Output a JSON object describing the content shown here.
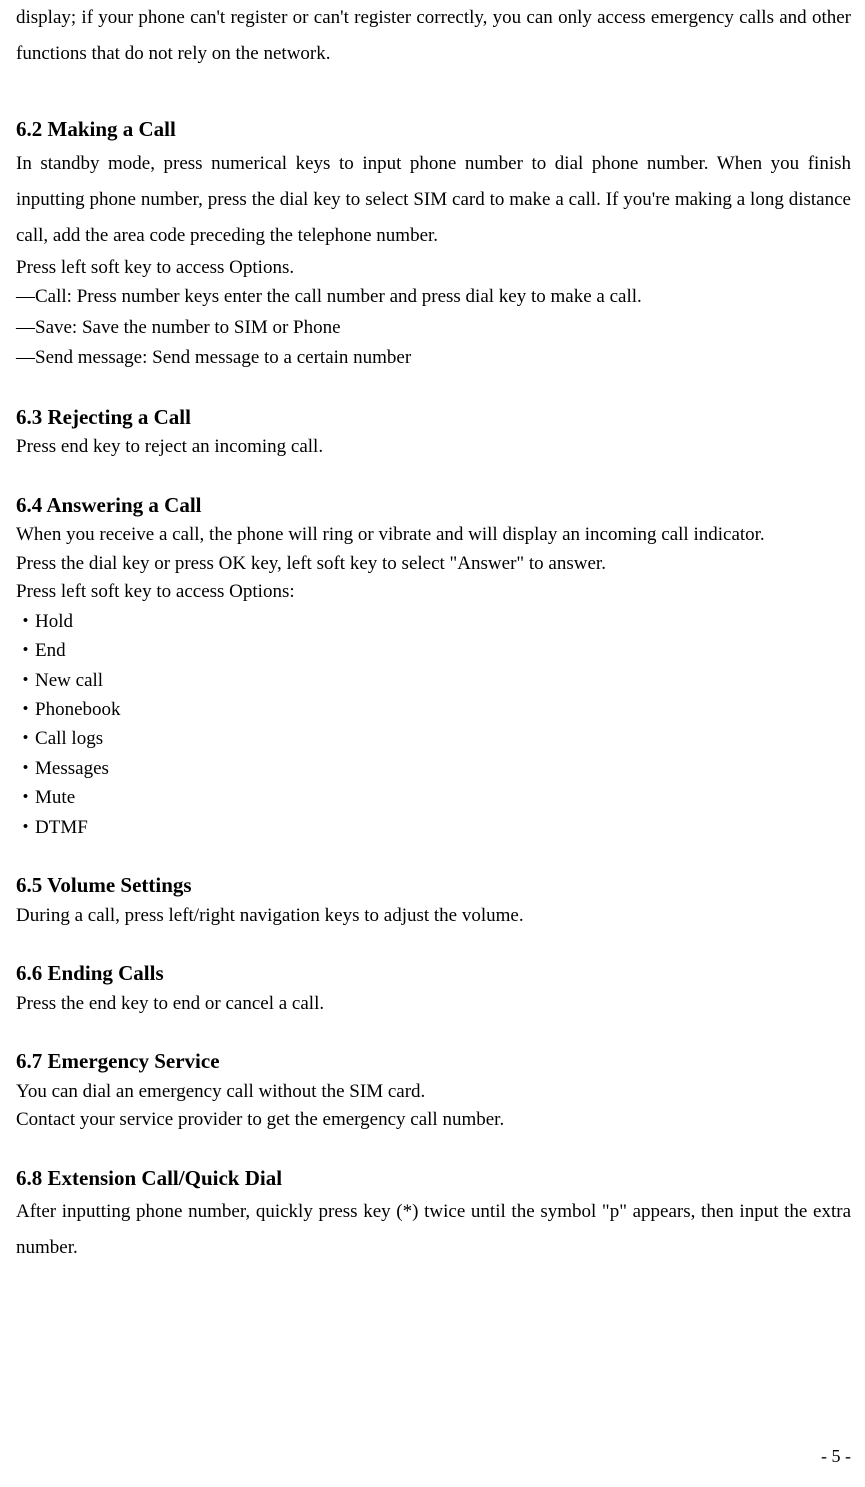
{
  "intro": {
    "p1": "display; if your phone can't register or can't register correctly, you can only access emergency calls and other functions that do not rely on the network."
  },
  "s62": {
    "heading": "6.2 Making a Call",
    "p1": "In standby mode, press numerical keys to input phone number to dial phone number. When you finish inputting phone number, press the dial key to select SIM card to make a call. If you're making a long distance call, add the area code preceding the telephone number.",
    "p2": "Press left soft key to access Options.",
    "items": [
      "Call: Press number keys enter the call number and press dial key to make a call.",
      "Save: Save the number to SIM or Phone",
      "Send message: Send message to a certain number"
    ]
  },
  "s63": {
    "heading": "6.3 Rejecting a Call",
    "p1": "Press end key to reject an incoming call."
  },
  "s64": {
    "heading": "6.4 Answering a Call",
    "p1": "When you receive a call, the phone will ring or vibrate and will display an incoming call indicator.",
    "p2": "Press the dial key or press OK key, left soft key to select \"Answer\" to answer.",
    "p3": "Press left soft key to access Options:",
    "bullets": [
      "Hold",
      "End",
      "New call",
      "Phonebook",
      "Call logs",
      "Messages",
      "Mute",
      "DTMF"
    ]
  },
  "s65": {
    "heading": "6.5 Volume Settings",
    "p1": "During a call, press left/right navigation keys to adjust the volume."
  },
  "s66": {
    "heading": "6.6 Ending Calls",
    "p1": "Press the end key to end or cancel a call."
  },
  "s67": {
    "heading": "6.7 Emergency Service",
    "p1": "You can dial an emergency call without the SIM card.",
    "p2": "Contact your service provider to get the emergency call number."
  },
  "s68": {
    "heading": "6.8 Extension Call/Quick Dial",
    "p1": "After inputting phone number, quickly press key (*) twice until the symbol \"p\" appears, then input the extra number."
  },
  "pagenum": "- 5 -"
}
